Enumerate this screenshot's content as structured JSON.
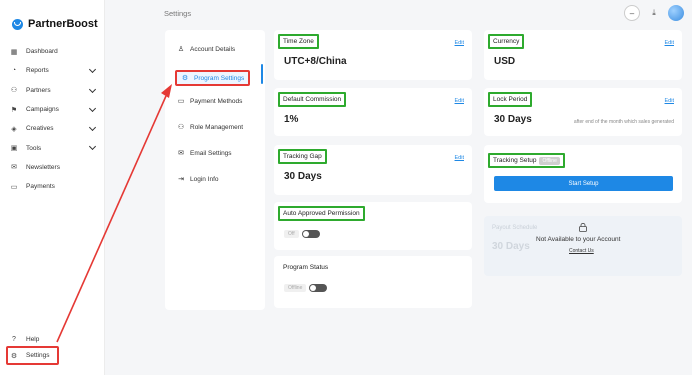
{
  "brand": {
    "name": "PartnerBoost"
  },
  "sidebar": {
    "items": [
      {
        "label": "Dashboard",
        "icon": "dashboard-icon",
        "glyph": "▦",
        "expandable": false
      },
      {
        "label": "Reports",
        "icon": "reports-icon",
        "glyph": "◔",
        "expandable": true
      },
      {
        "label": "Partners",
        "icon": "partners-icon",
        "glyph": "⚇",
        "expandable": true
      },
      {
        "label": "Campaigns",
        "icon": "campaigns-icon",
        "glyph": "⚑",
        "expandable": true
      },
      {
        "label": "Creatives",
        "icon": "creatives-icon",
        "glyph": "◈",
        "expandable": true
      },
      {
        "label": "Tools",
        "icon": "tools-icon",
        "glyph": "▣",
        "expandable": true
      },
      {
        "label": "Newsletters",
        "icon": "newsletters-icon",
        "glyph": "✉",
        "expandable": false
      },
      {
        "label": "Payments",
        "icon": "payments-icon",
        "glyph": "▭",
        "expandable": false
      }
    ],
    "help": {
      "label": "Help",
      "glyph": "?"
    },
    "settings": {
      "label": "Settings",
      "glyph": "⚙"
    }
  },
  "header": {
    "title": "Settings"
  },
  "settings_menu": {
    "items": [
      {
        "label": "Account Details",
        "glyph": "♙"
      },
      {
        "label": "Program Settings",
        "glyph": "⚙",
        "active": true
      },
      {
        "label": "Payment Methods",
        "glyph": "▭"
      },
      {
        "label": "Role Management",
        "glyph": "⚇"
      },
      {
        "label": "Email Settings",
        "glyph": "✉"
      },
      {
        "label": "Login Info",
        "glyph": "⇥"
      }
    ]
  },
  "cards": {
    "time_zone": {
      "label": "Time Zone",
      "value": "UTC+8/China",
      "edit": "Edit"
    },
    "currency": {
      "label": "Currency",
      "value": "USD",
      "edit": "Edit"
    },
    "default_commission": {
      "label": "Default Commission",
      "value": "1%",
      "edit": "Edit"
    },
    "lock_period": {
      "label": "Lock Period",
      "value": "30 Days",
      "edit": "Edit",
      "note": "after end of the month which sales generated"
    },
    "tracking_gap": {
      "label": "Tracking Gap",
      "value": "30 Days",
      "edit": "Edit"
    },
    "tracking_setup": {
      "label": "Tracking Setup",
      "tag": "Offline",
      "button": "Start Setup"
    },
    "auto_approved": {
      "label": "Auto Approved Permission",
      "toggle_text": "Off"
    },
    "program_status": {
      "label": "Program Status",
      "toggle_text": "Offline"
    },
    "payout_schedule": {
      "label": "Payout Schedule",
      "value": "30 Days",
      "not_available": "Not Available to your Account",
      "link": "Contact Us"
    }
  },
  "colors": {
    "accent": "#1e88e5",
    "highlight_green": "#2eaa2e",
    "highlight_red": "#e53935"
  }
}
